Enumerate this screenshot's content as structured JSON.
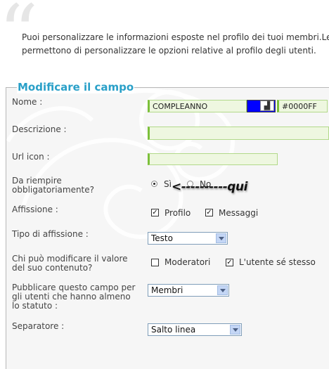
{
  "intro": {
    "line1": "Puoi personalizzare le informazioni esposte nel profilo dei tuoi membri.Le",
    "line2": "permettono di personalizzare le opzioni relative al profilo degli utenti."
  },
  "panel_title": "Modificare il campo",
  "fields": {
    "nome": {
      "label": "Nome :",
      "value": "COMPLEANNO",
      "color_value": "#0000FF",
      "swatch_color": "#0000ff"
    },
    "descrizione": {
      "label": "Descrizione :",
      "value": ""
    },
    "url_icon": {
      "label": "Url icon :",
      "value": ""
    },
    "obbligatorio": {
      "label_line1": "Da riempire",
      "label_line2": "obbligatoriamente?",
      "options": [
        "Sì",
        "No"
      ],
      "selected": "Sì",
      "annotation": "<----------qui"
    },
    "affissione": {
      "label": "Affissione :",
      "options": [
        {
          "label": "Profilo",
          "checked": true
        },
        {
          "label": "Messaggi",
          "checked": true
        }
      ]
    },
    "tipo_affissione": {
      "label": "Tipo di affissione :",
      "selected": "Testo"
    },
    "modifica": {
      "label_line1": "Chi può modificare il valore",
      "label_line2": "del suo contenuto?",
      "options": [
        {
          "label": "Moderatori",
          "checked": false
        },
        {
          "label": "L'utente sé stesso",
          "checked": true
        }
      ]
    },
    "pubblicare": {
      "label_line1": "Pubblicare questo campo per",
      "label_line2": "gli utenti che hanno almeno",
      "label_line3": "lo statuto :",
      "selected": "Membri"
    },
    "separatore": {
      "label": "Separatore :",
      "selected": "Salto linea"
    }
  },
  "colors": {
    "title": "#2aa0c8",
    "input_border": "#7cc03a",
    "input_bg": "#eef7e0"
  }
}
